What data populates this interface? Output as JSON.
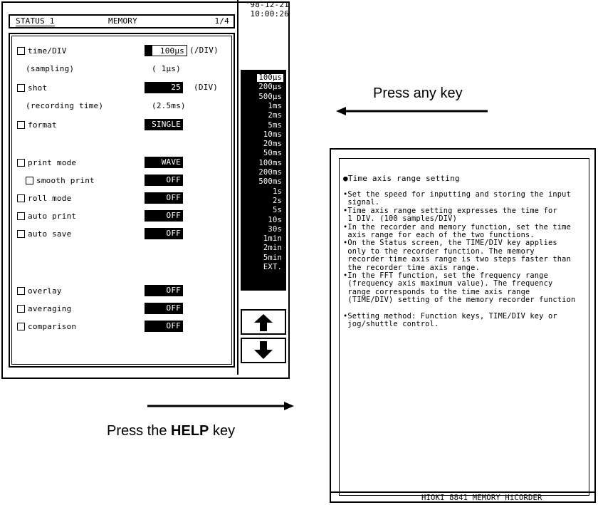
{
  "status_screen": {
    "tab_label": "STATUS 1",
    "mode": "MEMORY",
    "page": "1/4",
    "date": "'98-12-21",
    "time": "10:00:26",
    "rows": {
      "time_div": {
        "label": "time/DIV",
        "value": "100µs",
        "unit": "(/DIV)"
      },
      "sampling": {
        "label": "(sampling)",
        "value": "(  1µs)"
      },
      "shot": {
        "label": "shot",
        "value": "25",
        "unit": "(DIV)"
      },
      "recording_time": {
        "label": "(recording time)",
        "value": "(2.5ms)"
      },
      "format": {
        "label": "format",
        "value": "SINGLE"
      },
      "print_mode": {
        "label": "print mode",
        "value": "WAVE"
      },
      "smooth_print": {
        "label": "smooth print",
        "value": "OFF"
      },
      "roll_mode": {
        "label": "roll mode",
        "value": "OFF"
      },
      "auto_print": {
        "label": "auto print",
        "value": "OFF"
      },
      "auto_save": {
        "label": "auto save",
        "value": "OFF"
      },
      "overlay": {
        "label": "overlay",
        "value": "OFF"
      },
      "averaging": {
        "label": "averaging",
        "value": "OFF"
      },
      "comparison": {
        "label": "comparison",
        "value": "OFF"
      }
    },
    "range_list": [
      "100µs",
      "200µs",
      "500µs",
      "1ms",
      "2ms",
      "5ms",
      "10ms",
      "20ms",
      "50ms",
      "100ms",
      "200ms",
      "500ms",
      "1s",
      "2s",
      "5s",
      "10s",
      "30s",
      "1min",
      "2min",
      "5min",
      "EXT."
    ],
    "range_selected": "100µs",
    "up_icon": "arrow-up-icon",
    "down_icon": "arrow-down-icon"
  },
  "labels": {
    "press_any_key": "Press any key",
    "press_the": "Press the",
    "help_key": "HELP",
    "key": "key"
  },
  "help_screen": {
    "title": "●Time axis range setting",
    "lines": [
      "•Set the speed for inputting and storing the input",
      " signal.",
      "•Time axis range setting expresses the time for",
      " 1 DIV. (100 samples/DIV)",
      "•In the recorder and memory function, set the time",
      " axis range for each of the two functions.",
      "•On the Status screen, the TIME/DIV key applies",
      " only to the recorder function. The memory",
      " recorder time axis range is two steps faster than",
      " the recorder time axis range.",
      "•In the FFT function, set the frequency range",
      " (frequency axis maximum value). The frequency",
      " range corresponds to the time axis range",
      " (TIME/DIV) setting of the memory recorder function",
      "",
      "•Setting method: Function keys, TIME/DIV key or",
      " jog/shuttle control."
    ],
    "footer": "HIOKI 8841  MEMORY HiCORDER"
  }
}
